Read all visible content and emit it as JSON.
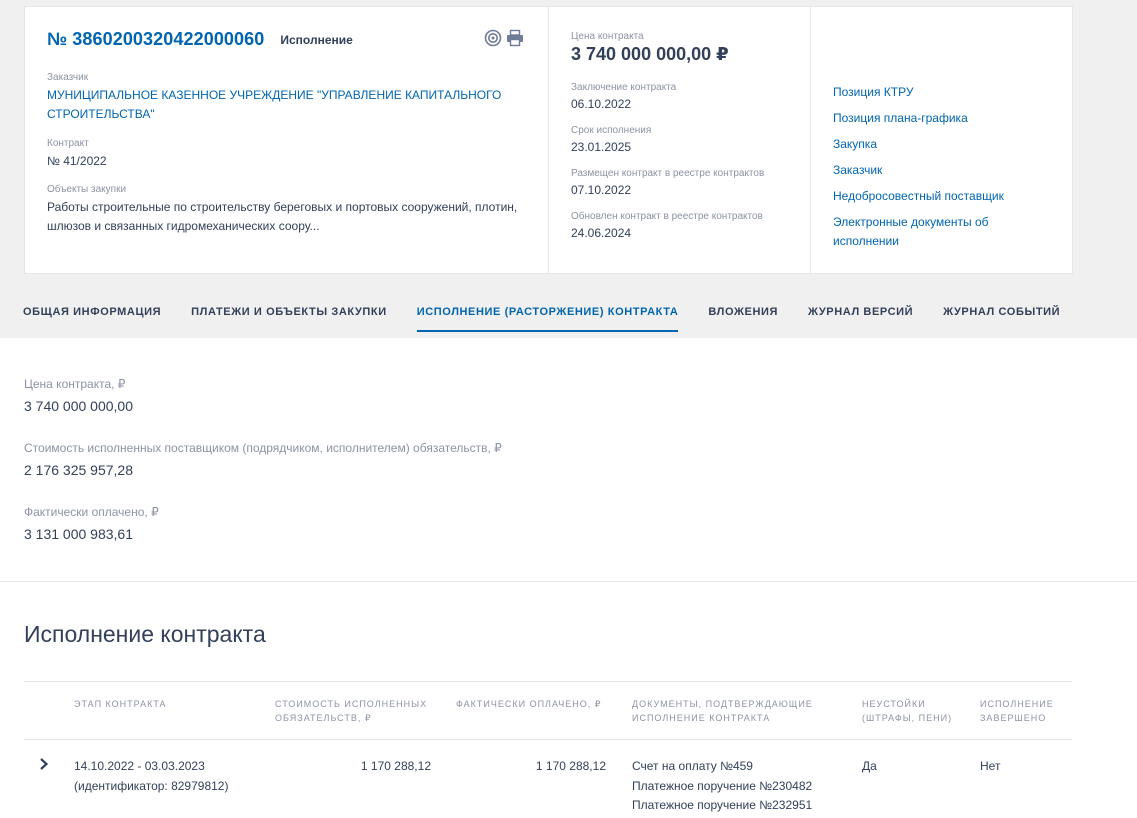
{
  "contract": {
    "number": "№ 3860200320422000060",
    "status": "Исполнение",
    "customer_label": "Заказчик",
    "customer_name": "МУНИЦИПАЛЬНОЕ КАЗЕННОЕ УЧРЕЖДЕНИЕ \"УПРАВЛЕНИЕ КАПИТАЛЬНОГО СТРОИТЕЛЬСТВА\"",
    "contract_label": "Контракт",
    "contract_value": "№ 41/2022",
    "objects_label": "Объекты закупки",
    "objects_value": "Работы строительные по строительству береговых и портовых сооружений, плотин, шлюзов и связанных гидромеханических соору...",
    "icons": [
      "target-icon",
      "print-icon"
    ]
  },
  "summary": {
    "price_label": "Цена контракта",
    "price_value": "3 740 000 000,00 ₽",
    "signed_label": "Заключение контракта",
    "signed_value": "06.10.2022",
    "term_label": "Срок исполнения",
    "term_value": "23.01.2025",
    "placed_label": "Размещен контракт в реестре контрактов",
    "placed_value": "07.10.2022",
    "updated_label": "Обновлен контракт в реестре контрактов",
    "updated_value": "24.06.2024"
  },
  "side_links": [
    "Позиция КТРУ",
    "Позиция плана-графика",
    "Закупка",
    "Заказчик",
    "Недобросовестный поставщик",
    "Электронные документы об исполнении"
  ],
  "tabs": [
    {
      "label": "ОБЩАЯ ИНФОРМАЦИЯ",
      "active": false
    },
    {
      "label": "ПЛАТЕЖИ И ОБЪЕКТЫ ЗАКУПКИ",
      "active": false
    },
    {
      "label": "ИСПОЛНЕНИЕ (РАСТОРЖЕНИЕ) КОНТРАКТА",
      "active": true
    },
    {
      "label": "ВЛОЖЕНИЯ",
      "active": false
    },
    {
      "label": "ЖУРНАЛ ВЕРСИЙ",
      "active": false
    },
    {
      "label": "ЖУРНАЛ СОБЫТИЙ",
      "active": false
    }
  ],
  "execution": {
    "price_label": "Цена контракта, ₽",
    "price_value": "3 740 000 000,00",
    "cost_label": "Стоимость исполненных поставщиком (подрядчиком, исполнителем) обязательств, ₽",
    "cost_value": "2 176 325 957,28",
    "paid_label": "Фактически оплачено, ₽",
    "paid_value": "3 131 000 983,61"
  },
  "section_title": "Исполнение контракта",
  "table": {
    "headers": {
      "stage": "ЭТАП КОНТРАКТА",
      "cost": "СТОИМОСТЬ ИСПОЛНЕННЫХ ОБЯЗАТЕЛЬСТВ, ₽",
      "paid": "ФАКТИЧЕСКИ ОПЛАЧЕНО, ₽",
      "docs": "ДОКУМЕНТЫ, ПОДТВЕРЖДАЮЩИЕ ИСПОЛНЕНИЕ КОНТРАКТА",
      "penalty": "НЕУСТОЙКИ (ШТРАФЫ, ПЕНИ)",
      "done": "ИСПОЛНЕНИЕ ЗАВЕРШЕНО"
    },
    "rows": [
      {
        "stage_dates": "14.10.2022 - 03.03.2023",
        "stage_id": "(идентификатор: 82979812)",
        "cost": "1 170 288,12",
        "paid": "1 170 288,12",
        "docs": [
          "Счет на оплату №459",
          "Платежное поручение №230482",
          "Платежное поручение №232951"
        ],
        "penalty": "Да",
        "done": "Нет"
      }
    ]
  }
}
